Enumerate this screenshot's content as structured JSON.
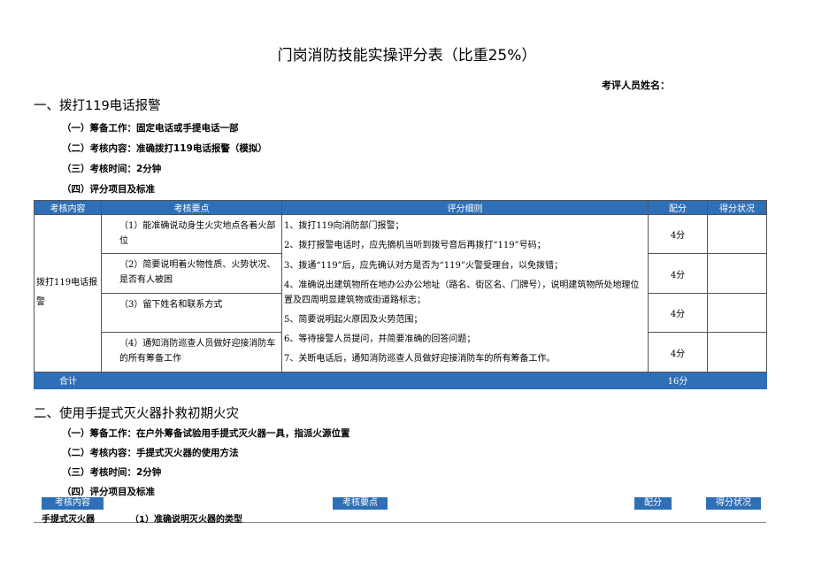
{
  "title": "门岗消防技能实操评分表（比重25%）",
  "examiner_label": "考评人员姓名：",
  "section1": {
    "heading": "一、拨打119电话报警",
    "prep": "（一）筹备工作：固定电话或手提电话一部",
    "content": "（二）考核内容：准确拨打119电话报警（模拟）",
    "time": "（三）考核时间：2分钟",
    "criteria": "（四）评分项目及标准",
    "table": {
      "headers": [
        "考核内容",
        "考核要点",
        "评分细则",
        "配分",
        "得分状况"
      ],
      "category": "拨打119电话报警",
      "points": [
        "（1）能准确说动身生火灾地点各着火部位",
        "（2）简要说明着火物性质、火势状况、是否有人被困",
        "（3）留下姓名和联系方式",
        "（4）通知消防巡查人员做好迎接消防车的所有筹备工作"
      ],
      "details": [
        "1、拨打119向消防部门报警；",
        "2、拨打报警电话时，应先摘机当听到拨号音后再拨打“119”号码；",
        "3、拨通“119”后，应先确认对方是否为“119”火警受理台，以免拨错；",
        "4、准确说出建筑物所在地办公办公地址（路名、街区名、门牌号），说明建筑物所处地理位置及四周明显建筑物或街道路标志；",
        "5、简要说明起火原因及火势范围；",
        "6、等待接警人员提问，并简要准确的回答问题；",
        "7、关断电话后，通知消防巡查人员做好迎接消防车的所有筹备工作。"
      ],
      "scores": [
        "4分",
        "4分",
        "4分",
        "4分"
      ],
      "total_label": "合计",
      "total_score": "16分"
    }
  },
  "section2": {
    "heading": "二、使用手提式灭火器扑救初期火灾",
    "prep": "（一）筹备工作：在户外筹备试验用手提式灭火器一具，指派火源位置",
    "content": "（二）考核内容：手提式灭火器的使用方法",
    "time": "（三）考核时间：2分钟",
    "criteria": "（四）评分项目及标准",
    "headers": [
      "考核内容",
      "考核要点",
      "配分",
      "得分状况"
    ],
    "row_category": "手提式灭火器",
    "row_point": "（1）准确说明灭火器的类型"
  }
}
